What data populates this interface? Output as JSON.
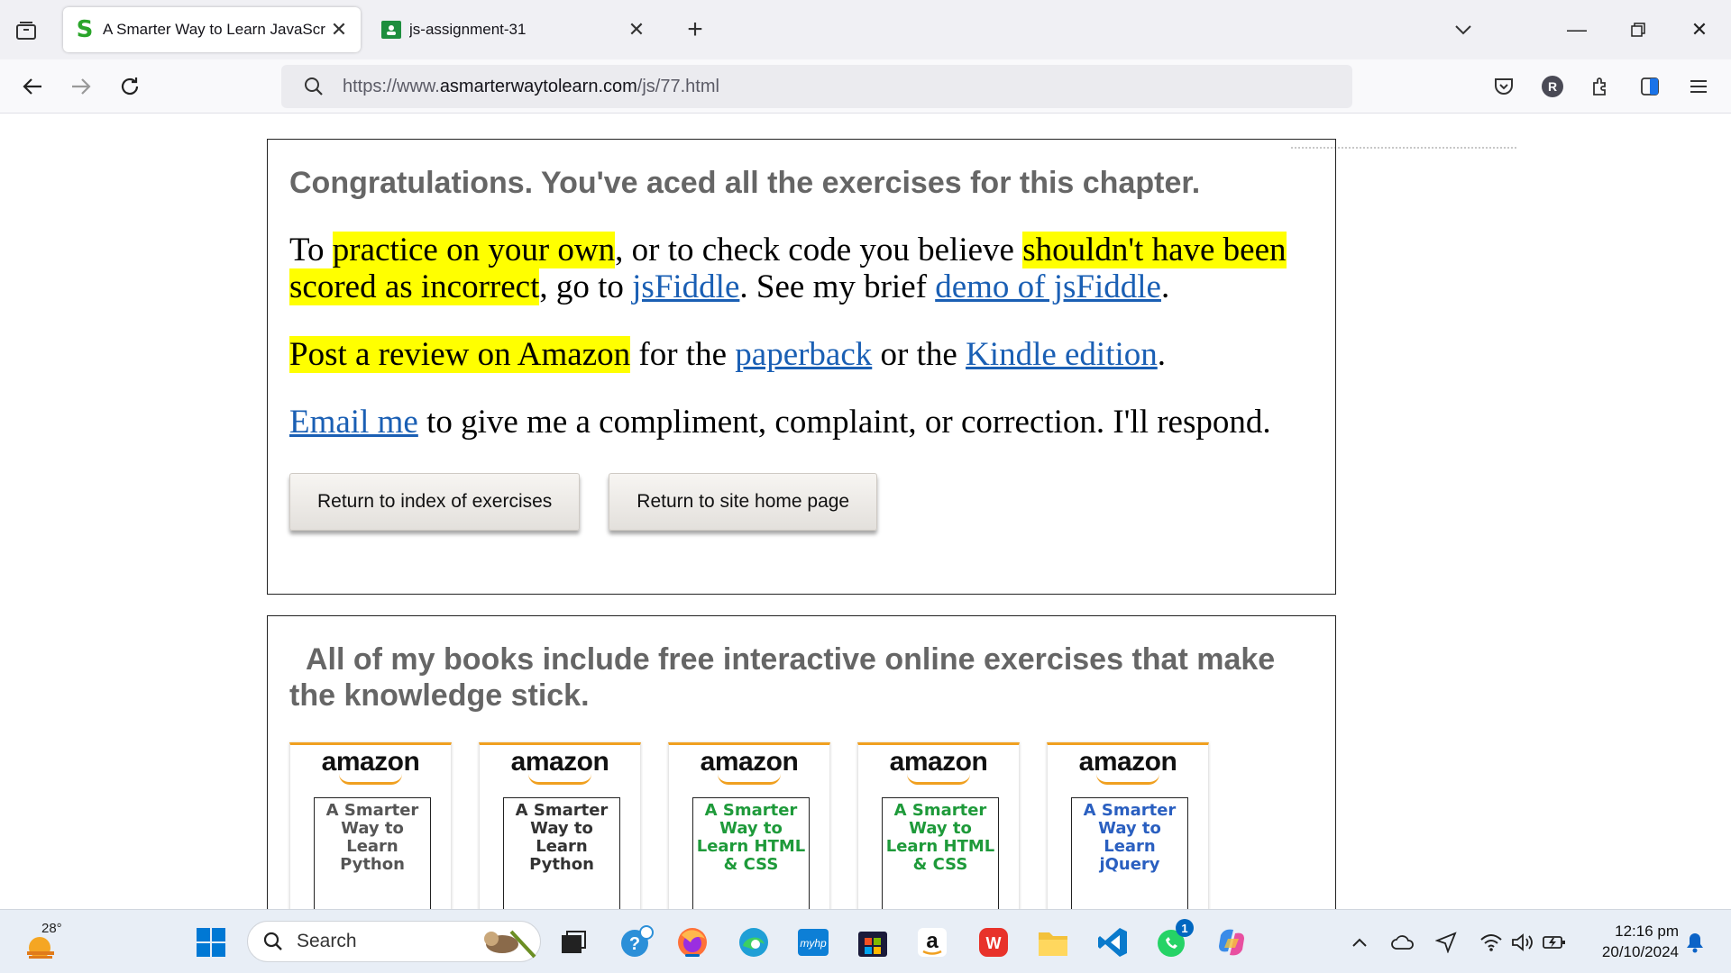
{
  "browser": {
    "tabs": [
      {
        "title": "A Smarter Way to Learn JavaScr",
        "favicon": "S",
        "active": true
      },
      {
        "title": "js-assignment-31",
        "favicon": "classroom-icon",
        "active": false
      }
    ],
    "url_prefix": "https://www.",
    "url_domain": "asmarterwaytolearn.com",
    "url_path": "/js/77.html",
    "profile_initial": "R"
  },
  "page": {
    "congrats_heading": "Congratulations. You've aced all the exercises for this chapter.",
    "p1": {
      "t1": "To ",
      "hl1": "practice on your own",
      "t2": ", or to check code you believe ",
      "hl2": "shouldn't have been scored as incorrect",
      "t3": ", go to ",
      "link1": "jsFiddle",
      "t4": ". See my brief ",
      "link2": "demo of jsFiddle",
      "t5": "."
    },
    "p2": {
      "hl": "Post a review on Amazon",
      "t1": " for the ",
      "link1": "paperback",
      "t2": " or the ",
      "link2": "Kindle edition",
      "t3": "."
    },
    "p3": {
      "link": "Email me",
      "t1": " to give me a compliment, complaint, or correction. I'll respond."
    },
    "buttons": {
      "index": "Return to index of exercises",
      "home": "Return to site home page"
    },
    "books_heading": "All of my books include free interactive online exercises that make the knowledge stick.",
    "books": [
      {
        "store": "amazon",
        "title": "A Smarter Way to Learn Python",
        "color": "#555555"
      },
      {
        "store": "amazon",
        "title": "A Smarter Way to Learn Python",
        "color": "#333333"
      },
      {
        "store": "amazon",
        "title": "A Smarter Way to Learn HTML & CSS",
        "color": "#1e9a3a"
      },
      {
        "store": "amazon",
        "title": "A Smarter Way to Learn HTML & CSS",
        "color": "#1e9a3a"
      },
      {
        "store": "amazon",
        "title": "A Smarter Way to Learn jQuery",
        "color": "#2a5fc0"
      }
    ]
  },
  "taskbar": {
    "temperature": "28°",
    "search_placeholder": "Search",
    "time": "12:16 pm",
    "date": "20/10/2024",
    "whatsapp_badge": "1"
  },
  "colors": {
    "highlight": "#ffff00",
    "link": "#1a5fb4",
    "heading_gray": "#666666",
    "amazon_orange": "#f0a020"
  }
}
